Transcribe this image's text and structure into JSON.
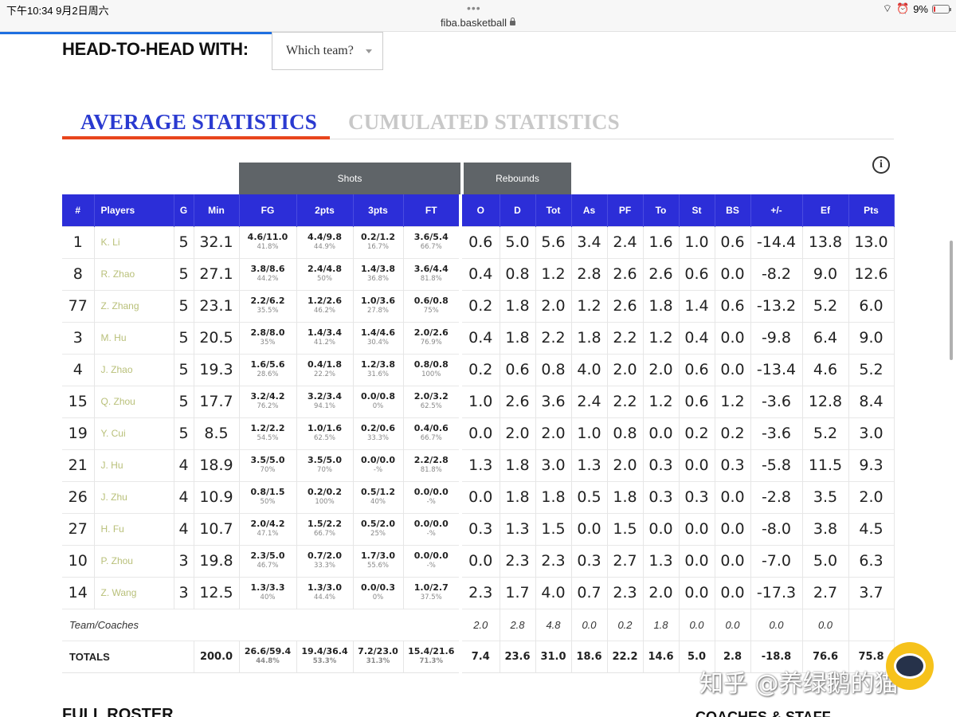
{
  "status_bar": {
    "time": "下午10:34  9月2日周六",
    "url": "fiba.basketball",
    "battery": "9%",
    "battery_level": 0.09
  },
  "head_to_head": {
    "label": "HEAD-TO-HEAD WITH:",
    "select_value": "Which team?"
  },
  "tabs": {
    "average": "AVERAGE STATISTICS",
    "cumulated": "CUMULATED STATISTICS"
  },
  "info_icon": "i",
  "groups": {
    "shots": "Shots",
    "rebounds": "Rebounds"
  },
  "columns": [
    "#",
    "Players",
    "G",
    "Min",
    "FG",
    "2pts",
    "3pts",
    "FT",
    "O",
    "D",
    "Tot",
    "As",
    "PF",
    "To",
    "St",
    "BS",
    "+/-",
    "Ef",
    "Pts"
  ],
  "players": [
    {
      "num": "1",
      "name": "K. Li",
      "g": "5",
      "min": "32.1",
      "fg": "4.6/11.0",
      "fg_p": "41.8%",
      "p2": "4.4/9.8",
      "p2_p": "44.9%",
      "p3": "0.2/1.2",
      "p3_p": "16.7%",
      "ft": "3.6/5.4",
      "ft_p": "66.7%",
      "o": "0.6",
      "d": "5.0",
      "tot": "5.6",
      "as": "3.4",
      "pf": "2.4",
      "to": "1.6",
      "st": "1.0",
      "bs": "0.6",
      "pm": "-14.4",
      "ef": "13.8",
      "pts": "13.0"
    },
    {
      "num": "8",
      "name": "R. Zhao",
      "g": "5",
      "min": "27.1",
      "fg": "3.8/8.6",
      "fg_p": "44.2%",
      "p2": "2.4/4.8",
      "p2_p": "50%",
      "p3": "1.4/3.8",
      "p3_p": "36.8%",
      "ft": "3.6/4.4",
      "ft_p": "81.8%",
      "o": "0.4",
      "d": "0.8",
      "tot": "1.2",
      "as": "2.8",
      "pf": "2.6",
      "to": "2.6",
      "st": "0.6",
      "bs": "0.0",
      "pm": "-8.2",
      "ef": "9.0",
      "pts": "12.6"
    },
    {
      "num": "77",
      "name": "Z. Zhang",
      "g": "5",
      "min": "23.1",
      "fg": "2.2/6.2",
      "fg_p": "35.5%",
      "p2": "1.2/2.6",
      "p2_p": "46.2%",
      "p3": "1.0/3.6",
      "p3_p": "27.8%",
      "ft": "0.6/0.8",
      "ft_p": "75%",
      "o": "0.2",
      "d": "1.8",
      "tot": "2.0",
      "as": "1.2",
      "pf": "2.6",
      "to": "1.8",
      "st": "1.4",
      "bs": "0.6",
      "pm": "-13.2",
      "ef": "5.2",
      "pts": "6.0"
    },
    {
      "num": "3",
      "name": "M. Hu",
      "g": "5",
      "min": "20.5",
      "fg": "2.8/8.0",
      "fg_p": "35%",
      "p2": "1.4/3.4",
      "p2_p": "41.2%",
      "p3": "1.4/4.6",
      "p3_p": "30.4%",
      "ft": "2.0/2.6",
      "ft_p": "76.9%",
      "o": "0.4",
      "d": "1.8",
      "tot": "2.2",
      "as": "1.8",
      "pf": "2.2",
      "to": "1.2",
      "st": "0.4",
      "bs": "0.0",
      "pm": "-9.8",
      "ef": "6.4",
      "pts": "9.0"
    },
    {
      "num": "4",
      "name": "J. Zhao",
      "g": "5",
      "min": "19.3",
      "fg": "1.6/5.6",
      "fg_p": "28.6%",
      "p2": "0.4/1.8",
      "p2_p": "22.2%",
      "p3": "1.2/3.8",
      "p3_p": "31.6%",
      "ft": "0.8/0.8",
      "ft_p": "100%",
      "o": "0.2",
      "d": "0.6",
      "tot": "0.8",
      "as": "4.0",
      "pf": "2.0",
      "to": "2.0",
      "st": "0.6",
      "bs": "0.0",
      "pm": "-13.4",
      "ef": "4.6",
      "pts": "5.2"
    },
    {
      "num": "15",
      "name": "Q. Zhou",
      "g": "5",
      "min": "17.7",
      "fg": "3.2/4.2",
      "fg_p": "76.2%",
      "p2": "3.2/3.4",
      "p2_p": "94.1%",
      "p3": "0.0/0.8",
      "p3_p": "0%",
      "ft": "2.0/3.2",
      "ft_p": "62.5%",
      "o": "1.0",
      "d": "2.6",
      "tot": "3.6",
      "as": "2.4",
      "pf": "2.2",
      "to": "1.2",
      "st": "0.6",
      "bs": "1.2",
      "pm": "-3.6",
      "ef": "12.8",
      "pts": "8.4"
    },
    {
      "num": "19",
      "name": "Y. Cui",
      "g": "5",
      "min": "8.5",
      "fg": "1.2/2.2",
      "fg_p": "54.5%",
      "p2": "1.0/1.6",
      "p2_p": "62.5%",
      "p3": "0.2/0.6",
      "p3_p": "33.3%",
      "ft": "0.4/0.6",
      "ft_p": "66.7%",
      "o": "0.0",
      "d": "2.0",
      "tot": "2.0",
      "as": "1.0",
      "pf": "0.8",
      "to": "0.0",
      "st": "0.2",
      "bs": "0.2",
      "pm": "-3.6",
      "ef": "5.2",
      "pts": "3.0"
    },
    {
      "num": "21",
      "name": "J. Hu",
      "g": "4",
      "min": "18.9",
      "fg": "3.5/5.0",
      "fg_p": "70%",
      "p2": "3.5/5.0",
      "p2_p": "70%",
      "p3": "0.0/0.0",
      "p3_p": "-%",
      "ft": "2.2/2.8",
      "ft_p": "81.8%",
      "o": "1.3",
      "d": "1.8",
      "tot": "3.0",
      "as": "1.3",
      "pf": "2.0",
      "to": "0.3",
      "st": "0.0",
      "bs": "0.3",
      "pm": "-5.8",
      "ef": "11.5",
      "pts": "9.3"
    },
    {
      "num": "26",
      "name": "J. Zhu",
      "g": "4",
      "min": "10.9",
      "fg": "0.8/1.5",
      "fg_p": "50%",
      "p2": "0.2/0.2",
      "p2_p": "100%",
      "p3": "0.5/1.2",
      "p3_p": "40%",
      "ft": "0.0/0.0",
      "ft_p": "-%",
      "o": "0.0",
      "d": "1.8",
      "tot": "1.8",
      "as": "0.5",
      "pf": "1.8",
      "to": "0.3",
      "st": "0.3",
      "bs": "0.0",
      "pm": "-2.8",
      "ef": "3.5",
      "pts": "2.0"
    },
    {
      "num": "27",
      "name": "H. Fu",
      "g": "4",
      "min": "10.7",
      "fg": "2.0/4.2",
      "fg_p": "47.1%",
      "p2": "1.5/2.2",
      "p2_p": "66.7%",
      "p3": "0.5/2.0",
      "p3_p": "25%",
      "ft": "0.0/0.0",
      "ft_p": "-%",
      "o": "0.3",
      "d": "1.3",
      "tot": "1.5",
      "as": "0.0",
      "pf": "1.5",
      "to": "0.0",
      "st": "0.0",
      "bs": "0.0",
      "pm": "-8.0",
      "ef": "3.8",
      "pts": "4.5"
    },
    {
      "num": "10",
      "name": "P. Zhou",
      "g": "3",
      "min": "19.8",
      "fg": "2.3/5.0",
      "fg_p": "46.7%",
      "p2": "0.7/2.0",
      "p2_p": "33.3%",
      "p3": "1.7/3.0",
      "p3_p": "55.6%",
      "ft": "0.0/0.0",
      "ft_p": "-%",
      "o": "0.0",
      "d": "2.3",
      "tot": "2.3",
      "as": "0.3",
      "pf": "2.7",
      "to": "1.3",
      "st": "0.0",
      "bs": "0.0",
      "pm": "-7.0",
      "ef": "5.0",
      "pts": "6.3"
    },
    {
      "num": "14",
      "name": "Z. Wang",
      "g": "3",
      "min": "12.5",
      "fg": "1.3/3.3",
      "fg_p": "40%",
      "p2": "1.3/3.0",
      "p2_p": "44.4%",
      "p3": "0.0/0.3",
      "p3_p": "0%",
      "ft": "1.0/2.7",
      "ft_p": "37.5%",
      "o": "2.3",
      "d": "1.7",
      "tot": "4.0",
      "as": "0.7",
      "pf": "2.3",
      "to": "2.0",
      "st": "0.0",
      "bs": "0.0",
      "pm": "-17.3",
      "ef": "2.7",
      "pts": "3.7"
    }
  ],
  "team_coaches": {
    "label": "Team/Coaches",
    "o": "2.0",
    "d": "2.8",
    "tot": "4.8",
    "as": "0.0",
    "pf": "0.2",
    "to": "1.8",
    "st": "0.0",
    "bs": "0.0",
    "pm": "0.0",
    "ef": "0.0",
    "pts": ""
  },
  "totals": {
    "label": "TOTALS",
    "min": "200.0",
    "fg": "26.6/59.4",
    "fg_p": "44.8%",
    "p2": "19.4/36.4",
    "p2_p": "53.3%",
    "p3": "7.2/23.0",
    "p3_p": "31.3%",
    "ft": "15.4/21.6",
    "ft_p": "71.3%",
    "o": "7.4",
    "d": "23.6",
    "tot": "31.0",
    "as": "18.6",
    "pf": "22.2",
    "to": "14.6",
    "st": "5.0",
    "bs": "2.8",
    "pm": "-18.8",
    "ef": "76.6",
    "pts": "75.8"
  },
  "bottom": {
    "left": "FULL ROSTER",
    "right": "COACHES & STAFF"
  },
  "watermark": "知乎 @养绿鹅的猫",
  "colors": {
    "header_blue": "#2c2ed8",
    "tab_active": "#2a3ad0",
    "tab_underline": "#e8451c",
    "group_gray": "#5f6468"
  }
}
